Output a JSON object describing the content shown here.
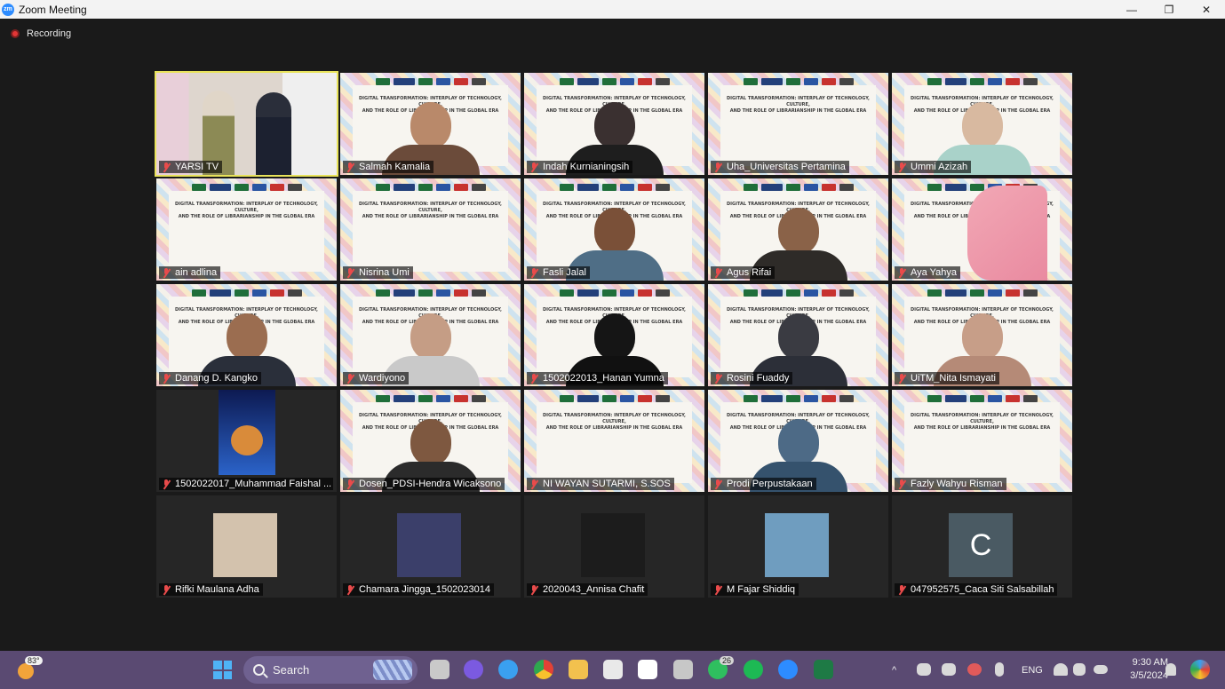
{
  "window": {
    "title": "Zoom Meeting",
    "app_icon_text": "zm",
    "controls": {
      "minimize": "—",
      "restore": "❐",
      "close": "✕"
    }
  },
  "meeting": {
    "recording_label": "Recording",
    "participants": [
      {
        "name": "YARSI TV",
        "kind": "video-stage"
      },
      {
        "name": "Salmah Kamalia",
        "kind": "banner-person",
        "skin": "#b9896a",
        "cloth": "#6b4b3a"
      },
      {
        "name": "Indah Kurnianingsih",
        "kind": "banner-person",
        "skin": "#3a3030",
        "cloth": "#1e1e1e"
      },
      {
        "name": "Uha_Universitas Pertamina",
        "kind": "banner"
      },
      {
        "name": "Ummi Azizah",
        "kind": "banner-person",
        "skin": "#d8b9a0",
        "cloth": "#a9d2c9"
      },
      {
        "name": "ain adlina",
        "kind": "banner"
      },
      {
        "name": "Nisrina Umi",
        "kind": "banner"
      },
      {
        "name": "Fasli Jalal",
        "kind": "banner-person",
        "skin": "#7a5038",
        "cloth": "#4f6e86"
      },
      {
        "name": "Agus Rifai",
        "kind": "banner-person",
        "skin": "#8a6248",
        "cloth": "#2e2b28"
      },
      {
        "name": "Aya Yahya",
        "kind": "banner-pink"
      },
      {
        "name": "Danang D. Kangko",
        "kind": "banner-person",
        "skin": "#9b6d50",
        "cloth": "#2a2f3a"
      },
      {
        "name": "Wardiyono",
        "kind": "banner-person",
        "skin": "#c59d85",
        "cloth": "#c9c9c9"
      },
      {
        "name": "1502022013_Hanan Yumna",
        "kind": "banner-person",
        "skin": "#151515",
        "cloth": "#111111"
      },
      {
        "name": "Rosini Fuaddy",
        "kind": "banner-person",
        "skin": "#3a3b42",
        "cloth": "#2c2f38"
      },
      {
        "name": "UiTM_Nita Ismayati",
        "kind": "banner-person",
        "skin": "#c79e88",
        "cloth": "#b58a77"
      },
      {
        "name": "1502022017_Muhammad Faishal ...",
        "kind": "avatar-dog"
      },
      {
        "name": "Dosen_PDSI-Hendra Wicaksono",
        "kind": "banner-person",
        "skin": "#7e5840",
        "cloth": "#2b2b2b"
      },
      {
        "name": "NI WAYAN SUTARMI, S.SOS",
        "kind": "banner"
      },
      {
        "name": "Prodi Perpustakaan",
        "kind": "banner-person",
        "skin": "#4d6a86",
        "cloth": "#35526d"
      },
      {
        "name": "Fazly Wahyu Risman",
        "kind": "banner"
      },
      {
        "name": "Rifki Maulana Adha",
        "kind": "thumb",
        "thumb_color": "#d3c2ad"
      },
      {
        "name": "Chamara Jingga_1502023014",
        "kind": "thumb",
        "thumb_color": "#3b3f6a"
      },
      {
        "name": "2020043_Annisa Chafit",
        "kind": "thumb",
        "thumb_color": "#1c1c1c"
      },
      {
        "name": "M Fajar Shiddiq",
        "kind": "thumb",
        "thumb_color": "#6f9dbf"
      },
      {
        "name": "047952575_Caca Siti Salsabillah",
        "kind": "letter",
        "letter": "C"
      }
    ],
    "banner_title_line1": "DIGITAL TRANSFORMATION: INTERPLAY OF TECHNOLOGY, CULTURE,",
    "banner_title_line2": "AND THE ROLE OF LIBRARIANSHIP IN THE GLOBAL ERA",
    "banner_logo": "YARSI"
  },
  "taskbar": {
    "weather_temp": "83°",
    "search_placeholder": "Search",
    "whatsapp_badge": "26",
    "language": "ENG",
    "time": "9:30 AM",
    "date": "3/5/2024",
    "tray_chevron": "^"
  },
  "colors": {
    "active_speaker": "#e8e35a",
    "muted_mic": "#e94b4b",
    "taskbar": "#5a4a72"
  }
}
